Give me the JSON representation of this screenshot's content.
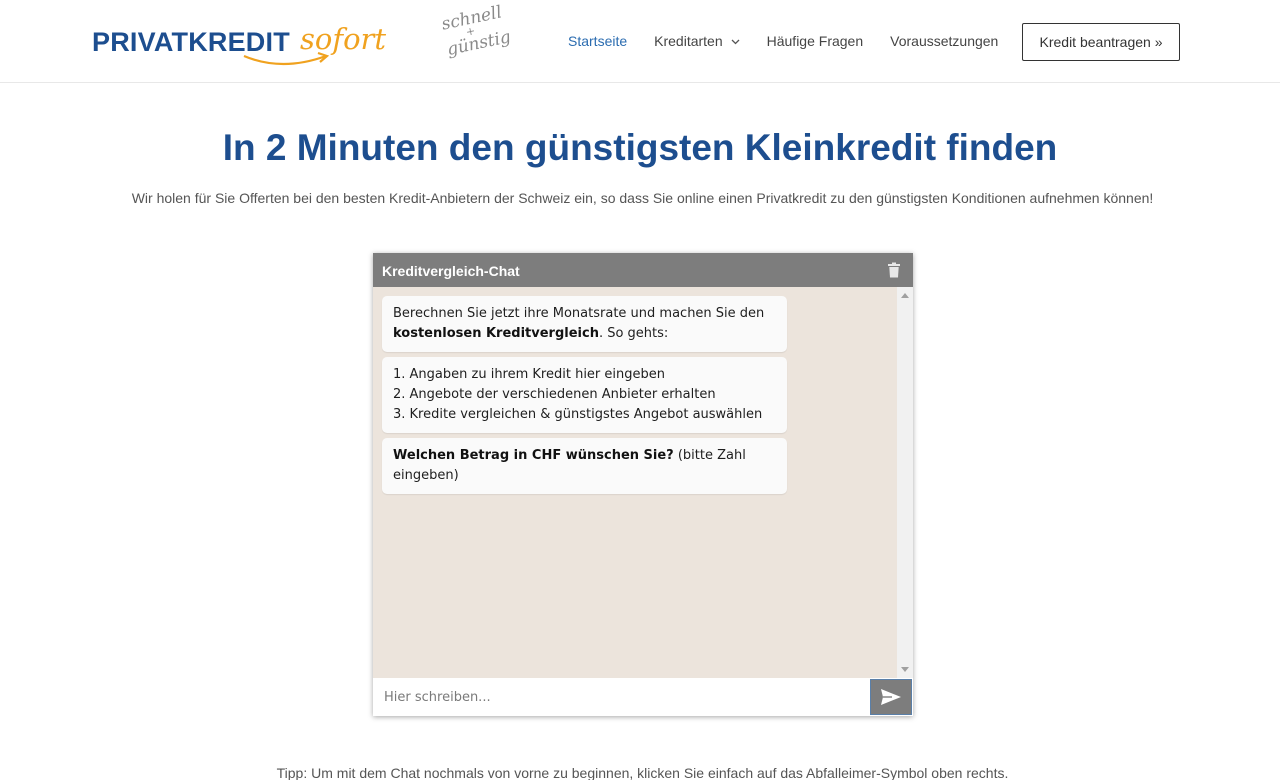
{
  "brand": {
    "name_main": "PRIVATKREDIT",
    "name_accent": "sofort",
    "tagline_top": "schnell",
    "tagline_plus": "+",
    "tagline_bottom": "günstig"
  },
  "nav": {
    "items": [
      {
        "label": "Startseite",
        "active": true
      },
      {
        "label": "Kreditarten",
        "has_dropdown": true
      },
      {
        "label": "Häufige Fragen"
      },
      {
        "label": "Voraussetzungen"
      }
    ],
    "cta_label": "Kredit beantragen »"
  },
  "hero": {
    "title": "In 2 Minuten den günstigsten Kleinkredit finden",
    "subtitle": "Wir holen für Sie Offerten bei den besten Kredit-Anbietern der Schweiz ein, so dass Sie online einen Privatkredit zu den günstigsten Konditionen aufnehmen können!"
  },
  "chat": {
    "title": "Kreditvergleich-Chat",
    "trash_icon": "trash-icon",
    "messages": [
      {
        "line1": "Berechnen Sie jetzt ihre Monatsrate und machen Sie den",
        "bold": "kostenlosen Kreditvergleich",
        "rest": ". So gehts:"
      },
      {
        "steps": [
          "1. Angaben zu ihrem Kredit hier eingeben",
          "2. Angebote der verschiedenen Anbieter erhalten",
          "3. Kredite vergleichen & günstigstes Angebot auswählen"
        ]
      },
      {
        "bold": "Welchen Betrag in CHF wünschen Sie?",
        "rest": " (bitte Zahl eingeben)"
      }
    ],
    "input_placeholder": "Hier schreiben...",
    "input_value": "",
    "send_icon": "send-icon"
  },
  "footer": {
    "tip": "Tipp: Um mit dem Chat nochmals von vorne zu beginnen, klicken Sie einfach auf das Abfalleimer-Symbol oben rechts."
  },
  "colors": {
    "brand_blue": "#1d4e8f",
    "brand_orange": "#f0a21f",
    "nav_active": "#2b6cb0",
    "chat_header": "#7d7d7d",
    "chat_background": "#ece4dc"
  }
}
